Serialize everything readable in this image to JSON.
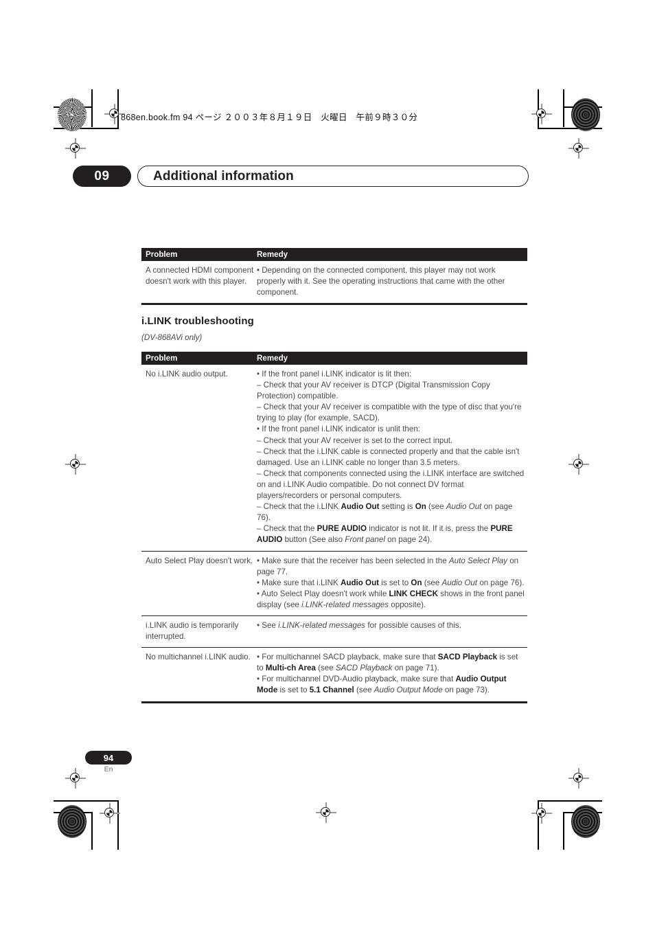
{
  "print_header": {
    "file_line": "868en.book.fm  94 ページ  ２００３年８月１９日　火曜日　午前９時３０分"
  },
  "chapter": {
    "number": "09",
    "title": "Additional information"
  },
  "table_hdmi": {
    "headers": {
      "problem": "Problem",
      "remedy": "Remedy"
    },
    "rows": [
      {
        "problem": "A connected HDMI component doesn't work with this player.",
        "remedy_html": "• Depending on the connected component, this player may not work properly with it. See the operating instructions that came with the other component."
      }
    ]
  },
  "section": {
    "heading": "i.LINK troubleshooting",
    "subheading": "(DV-868AVi only)"
  },
  "table_ilink": {
    "headers": {
      "problem": "Problem",
      "remedy": "Remedy"
    },
    "rows": [
      {
        "problem": "No i.LINK audio output.",
        "remedy_html": "• If the front panel i.LINK indicator is lit then:<br>– Check that your AV receiver is DTCP (Digital Transmission Copy Protection) compatible.<br>– Check that your AV receiver is compatible with the type of disc that you're trying to play (for example, SACD).<br>• If the front panel i.LINK indicator is unlit then:<br>– Check that your AV receiver is set to the correct input.<br>– Check that the i.LINK cable is connected properly and that the cable isn't damaged. Use an i.LINK cable no longer than 3.5 meters.<br>– Check that components connected using the i.LINK interface are switched on and i.LINK Audio compatible. Do not connect DV format players/recorders or personal computers.<br>– Check that the i.LINK <b>Audio Out</b> setting is <b>On</b> (see <i>Audio Out</i> on page 76).<br>– Check that the <b>PURE AUDIO</b> indicator is not lit. If it is, press the <b>PURE AUDIO</b> button (See also <i>Front panel</i> on page 24)."
      },
      {
        "problem": "Auto Select Play doesn't work.",
        "remedy_html": "• Make sure that the receiver has been selected in the <i>Auto Select Play</i> on page 77.<br>• Make sure that i.LINK <b>Audio Out</b> is set to <b>On</b> (see <i>Audio Out</i> on page 76).<br>• Auto Select Play doesn't work while <b>LINK CHECK</b> shows in the front panel display (see <i>i.LINK-related messages</i> opposite)."
      },
      {
        "problem": "i.LINK audio is temporarily interrupted.",
        "remedy_html": "• See <i>i.LINK-related messages</i> for possible causes of this."
      },
      {
        "problem": "No multichannel i.LINK audio.",
        "remedy_html": "• For multichannel SACD playback, make sure that <b>SACD Playback</b> is set to <b>Multi-ch Area</b> (see <i>SACD Playback</i> on page 71).<br>• For multichannel DVD-Audio playback, make sure that <b>Audio Output Mode</b> is set to <b>5.1 Channel</b> (see <i>Audio Output Mode</i> on page 73)."
      }
    ]
  },
  "footer": {
    "page_number": "94",
    "language": "En"
  },
  "colors": {
    "ink": "#231f20",
    "body_text": "#4a4a4a",
    "paper": "#ffffff"
  }
}
